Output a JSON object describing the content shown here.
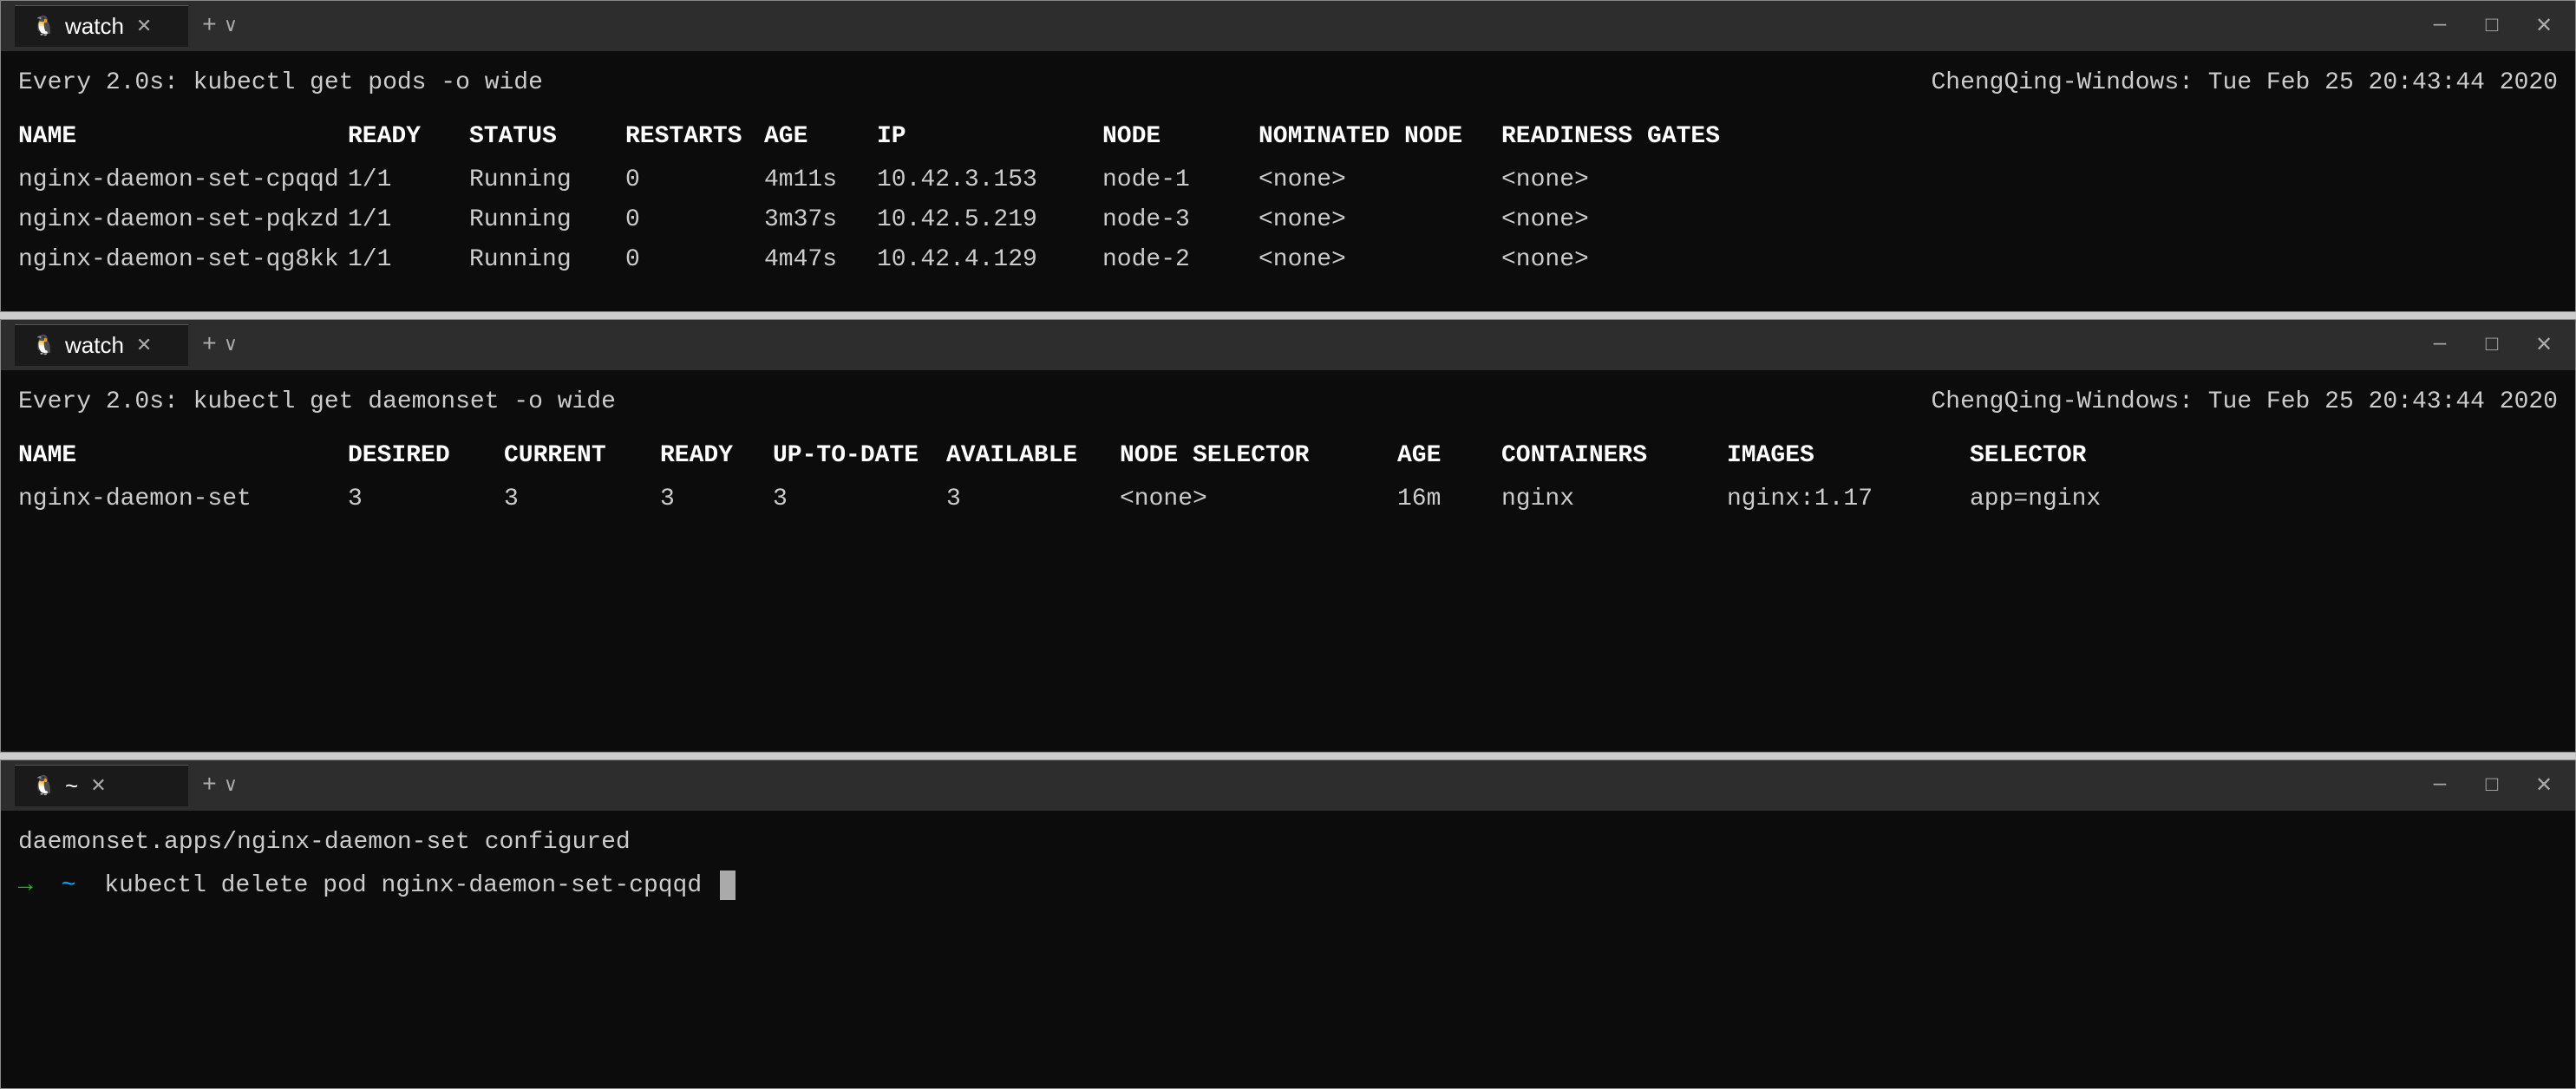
{
  "terminal1": {
    "tab_title": "watch",
    "watch_cmd": "Every 2.0s: kubectl get pods -o wide",
    "host_info": "ChengQing-Windows: Tue Feb 25 20:43:44 2020",
    "headers": [
      "NAME",
      "READY",
      "STATUS",
      "RESTARTS",
      "AGE",
      "IP",
      "NODE",
      "NOMINATED NODE",
      "READINESS GATES"
    ],
    "rows": [
      [
        "nginx-daemon-set-cpqqd",
        "1/1",
        "Running",
        "0",
        "4m11s",
        "10.42.3.153",
        "node-1",
        "<none>",
        "<none>"
      ],
      [
        "nginx-daemon-set-pqkzd",
        "1/1",
        "Running",
        "0",
        "3m37s",
        "10.42.5.219",
        "node-3",
        "<none>",
        "<none>"
      ],
      [
        "nginx-daemon-set-qg8kk",
        "1/1",
        "Running",
        "0",
        "4m47s",
        "10.42.4.129",
        "node-2",
        "<none>",
        "<none>"
      ]
    ]
  },
  "terminal2": {
    "tab_title": "watch",
    "watch_cmd": "Every 2.0s: kubectl get daemonset -o wide",
    "host_info": "ChengQing-Windows: Tue Feb 25 20:43:44 2020",
    "headers": [
      "NAME",
      "DESIRED",
      "CURRENT",
      "READY",
      "UP-TO-DATE",
      "AVAILABLE",
      "NODE SELECTOR",
      "AGE",
      "CONTAINERS",
      "IMAGES",
      "SELECTOR"
    ],
    "rows": [
      [
        "nginx-daemon-set",
        "3",
        "3",
        "3",
        "3",
        "3",
        "<none>",
        "16m",
        "nginx",
        "nginx:1.17",
        "app=nginx"
      ]
    ]
  },
  "terminal3": {
    "tab_title": "~",
    "line1": "daemonset.apps/nginx-daemon-set configured",
    "prompt_arrow": "→",
    "prompt_tilde": "~",
    "prompt_command": "kubectl delete pod nginx-daemon-set-cpqqd"
  },
  "controls": {
    "minimize": "─",
    "maximize": "□",
    "close": "✕",
    "new_tab": "+",
    "dropdown": "∨"
  }
}
